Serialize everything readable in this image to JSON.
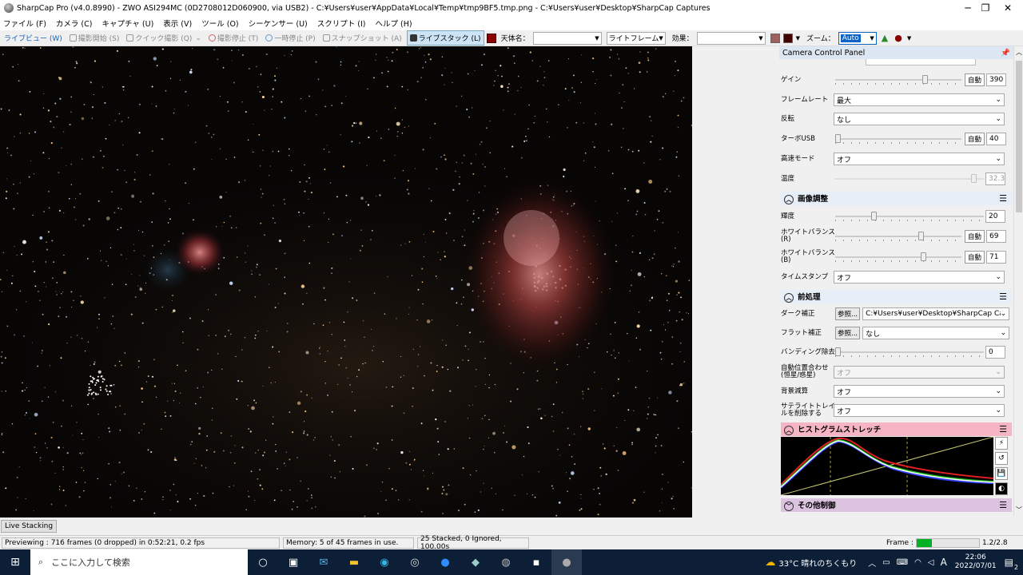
{
  "window": {
    "title": "SharpCap Pro (v4.0.8990) - ZWO ASI294MC (0D2708012D060900, via USB2) - C:¥Users¥user¥AppData¥Local¥Temp¥tmp9BF5.tmp.png - C:¥Users¥user¥Desktop¥SharpCap Captures",
    "minimize": "─",
    "maximize": "❐",
    "close": "✕"
  },
  "menu": [
    "ファイル (F)",
    "カメラ (C)",
    "キャプチャ (U)",
    "表示 (V)",
    "ツール (O)",
    "シーケンサー (U)",
    "スクリプト (I)",
    "ヘルプ (H)"
  ],
  "toolbar": {
    "live_view": "ライブビュー (W)",
    "start_capture": "撮影開始 (S)",
    "quick_capture": "クイック撮影 (Q)",
    "stop_capture": "撮影停止 (T)",
    "pause": "一時停止 (P)",
    "snapshot": "スナップショット (A)",
    "live_stack": "ライブスタック (L)",
    "object_label": "天体名：",
    "object_value": "",
    "frame_value": "ライトフレーム",
    "effect_label": "効果：",
    "effect_value": "",
    "zoom_label": "ズーム：",
    "zoom_value": "Auto"
  },
  "panel": {
    "title": "Camera Control Panel",
    "pin_icon": "pin-icon",
    "camera_rows": [
      {
        "label": "ゲイン",
        "auto": "自動",
        "value": "390",
        "level": 0.72
      },
      {
        "label": "フレームレート",
        "select": "最大"
      },
      {
        "label": "反転",
        "select": "なし"
      },
      {
        "label": "ターボUSB",
        "auto": "自動",
        "value": "40",
        "level": 0.0
      },
      {
        "label": "高速モード",
        "select": "オフ"
      },
      {
        "label": "温度",
        "value": "32.3",
        "level": 0.95
      }
    ],
    "image_section": {
      "title": "画像調整",
      "rows": [
        {
          "label": "輝度",
          "value": "20",
          "level": 0.25
        },
        {
          "label": "ホワイトバランス(R)",
          "auto": "自動",
          "value": "69",
          "level": 0.69
        },
        {
          "label": "ホワイトバランス(B)",
          "auto": "自動",
          "value": "71",
          "level": 0.71
        },
        {
          "label": "タイムスタンプ",
          "select": "オフ"
        }
      ]
    },
    "preprocess_section": {
      "title": "前処理",
      "rows": [
        {
          "label": "ダーク補正",
          "button": "参照...",
          "select": "C:¥Users¥user¥Desktop¥SharpCap Ca..."
        },
        {
          "label": "フラット補正",
          "button": "参照...",
          "select": "なし"
        },
        {
          "label": "バンディング除去",
          "value": "0",
          "level": 0.0
        },
        {
          "label": "自動位置合わせ (恒星/惑星)",
          "select": "オフ",
          "disabled": true
        },
        {
          "label": "背景減算",
          "select": "オフ"
        },
        {
          "label": "サテライトトレイルを削除する",
          "select": "オフ"
        }
      ]
    },
    "histogram_section": {
      "title": "ヒストグラムストレッチ",
      "color": "#f7b4c4"
    },
    "other_section": {
      "title": "その他制御",
      "color": "#dcc4e0"
    }
  },
  "live_stacking_tab": "Live Stacking",
  "status": {
    "preview": "Previewing : 716 frames (0 dropped) in 0:52:21, 0.2 fps",
    "memory": "Memory: 5 of 45 frames in use.",
    "stacked": "25 Stacked, 0 Ignored, 100.00s",
    "frame_label": "Frame :",
    "frame_progress": 0.25,
    "frame_count": "1.2/2.8"
  },
  "taskbar": {
    "search_placeholder": "ここに入力して検索",
    "weather": "33°C  晴れのちくもり",
    "ime": "A",
    "time": "22:06",
    "date": "2022/07/01",
    "notify_count": "2"
  }
}
